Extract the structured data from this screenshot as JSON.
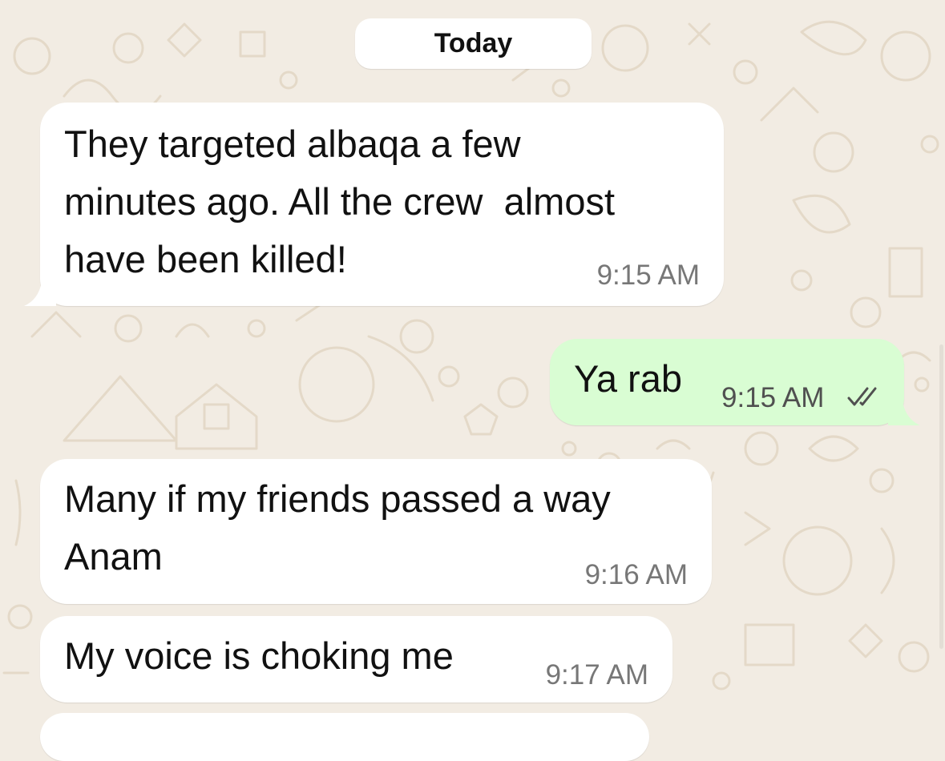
{
  "chat": {
    "date_divider": "Today",
    "messages": [
      {
        "direction": "incoming",
        "text": "They targeted albaqa a few\nminutes ago. All the crew  almost\nhave been killed!",
        "time": "9:15 AM"
      },
      {
        "direction": "outgoing",
        "text": "Ya rab",
        "time": "9:15 AM",
        "status_icon": "double-check-read-icon"
      },
      {
        "direction": "incoming",
        "text": "Many if my friends passed a way\nAnam",
        "time": "9:16 AM"
      },
      {
        "direction": "incoming",
        "text": "My voice is choking me",
        "time": "9:17 AM"
      }
    ]
  },
  "colors": {
    "background": "#f2ece3",
    "doodle": "#e4d9c8",
    "incoming_bubble": "#ffffff",
    "outgoing_bubble": "#d9fdd3",
    "timestamp": "#777777"
  }
}
